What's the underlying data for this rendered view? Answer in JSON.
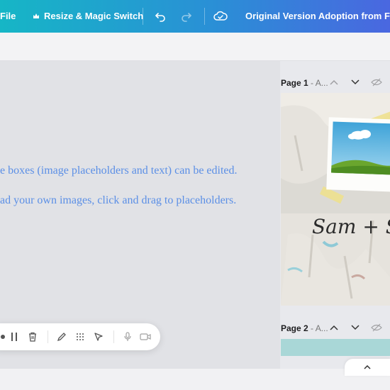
{
  "topbar": {
    "file_label": "File",
    "resize_label": "Resize & Magic Switch",
    "doc_title": "Original Version Adoption from Fosterc"
  },
  "canvas": {
    "line1": "e boxes (image placeholders and text) can be edited.",
    "line2": "ad your own images, click and drag to placeholders."
  },
  "pages": [
    {
      "label": "Page 1",
      "sub": " - A..."
    },
    {
      "label": "Page 2",
      "sub": " - A..."
    }
  ],
  "thumbnail": {
    "names_text": "Sam + Sa"
  },
  "colors": {
    "accent_start": "#16b6c6",
    "accent_end": "#4a67e0",
    "canvas_text": "#5b8fe6",
    "page2_thumb": "#a9d7d7"
  }
}
